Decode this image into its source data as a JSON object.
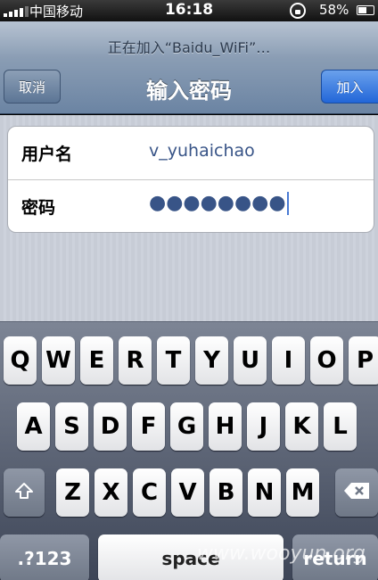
{
  "status_bar": {
    "carrier": "中国移动",
    "time": "16:18",
    "battery_percent_text": "58%",
    "battery_level": 0.58
  },
  "nav": {
    "prompt": "正在加入“Baidu_WiFi”…",
    "title": "输入密码",
    "cancel_label": "取消",
    "join_label": "加入"
  },
  "form": {
    "username_label": "用户名",
    "username_value": "v_yuhaichao",
    "password_label": "密码",
    "password_value": "●●●●●●●●"
  },
  "keyboard": {
    "row1": [
      "Q",
      "W",
      "E",
      "R",
      "T",
      "Y",
      "U",
      "I",
      "O",
      "P"
    ],
    "row2": [
      "A",
      "S",
      "D",
      "F",
      "G",
      "H",
      "J",
      "K",
      "L"
    ],
    "row3": [
      "Z",
      "X",
      "C",
      "V",
      "B",
      "N",
      "M"
    ],
    "numbers_label": ".?123",
    "space_label": "space",
    "return_label": "return",
    "shift_icon": "shift-icon",
    "backspace_icon": "backspace-icon"
  },
  "watermark": "www.wooyun.org"
}
